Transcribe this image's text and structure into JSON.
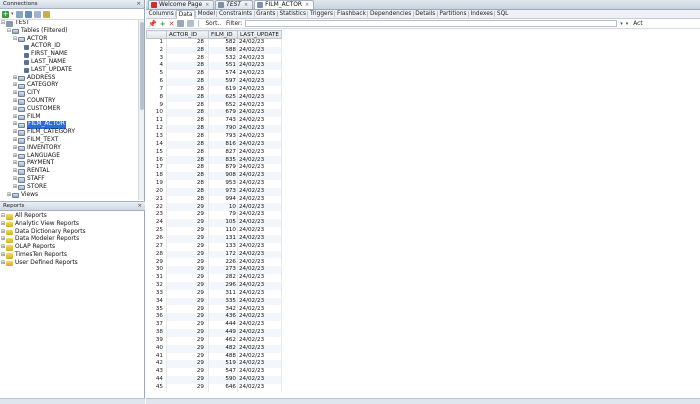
{
  "connections_panel": {
    "title": "Connections",
    "close": "×"
  },
  "tree": {
    "connection": "TEST",
    "tables_folder": "Tables (Filtered)",
    "actor_table": "ACTOR",
    "actor_columns": [
      "ACTOR_ID",
      "FIRST_NAME",
      "LAST_NAME",
      "LAST_UPDATE"
    ],
    "tables": [
      "ADDRESS",
      "CATEGORY",
      "CITY",
      "COUNTRY",
      "CUSTOMER",
      "FILM",
      "FILM_ACTOR",
      "FILM_CATEGORY",
      "FILM_TEXT",
      "INVENTORY",
      "LANGUAGE",
      "PAYMENT",
      "RENTAL",
      "STAFF",
      "STORE"
    ],
    "selected_table": "FILM_ACTOR",
    "views": "Views"
  },
  "reports_panel": {
    "title": "Reports",
    "close": "×",
    "root": "All Reports",
    "items": [
      "Analytic View Reports",
      "Data Dictionary Reports",
      "Data Modeler Reports",
      "OLAP Reports",
      "TimesTen Reports",
      "User Defined Reports"
    ]
  },
  "editor_tabs": [
    {
      "label": "Welcome Page",
      "icon": "oracle-icon",
      "active": false
    },
    {
      "label": "TEST",
      "icon": "connection-icon",
      "active": false
    },
    {
      "label": "FILM_ACTOR",
      "icon": "table-icon",
      "active": true
    }
  ],
  "editor_close": "×",
  "sub_tabs": [
    "Columns",
    "Data",
    "Model",
    "Constraints",
    "Grants",
    "Statistics",
    "Triggers",
    "Flashback",
    "Dependencies",
    "Details",
    "Partitions",
    "Indexes",
    "SQL"
  ],
  "active_sub_tab": "Data",
  "data_toolbar": {
    "sort_label": "Sort..",
    "filter_label": "Filter:",
    "filter_value": "",
    "actions_label": "Act"
  },
  "grid": {
    "columns": [
      "ACTOR_ID",
      "FILM_ID",
      "LAST_UPDATE"
    ],
    "rows": [
      [
        "1",
        "28",
        "582",
        "24/02/23"
      ],
      [
        "2",
        "28",
        "588",
        "24/02/23"
      ],
      [
        "3",
        "28",
        "532",
        "24/02/23"
      ],
      [
        "4",
        "28",
        "551",
        "24/02/23"
      ],
      [
        "5",
        "28",
        "574",
        "24/02/23"
      ],
      [
        "6",
        "28",
        "597",
        "24/02/23"
      ],
      [
        "7",
        "28",
        "619",
        "24/02/23"
      ],
      [
        "8",
        "28",
        "625",
        "24/02/23"
      ],
      [
        "9",
        "28",
        "652",
        "24/02/23"
      ],
      [
        "10",
        "28",
        "679",
        "24/02/23"
      ],
      [
        "11",
        "28",
        "743",
        "24/02/23"
      ],
      [
        "12",
        "28",
        "790",
        "24/02/23"
      ],
      [
        "13",
        "28",
        "793",
        "24/02/23"
      ],
      [
        "14",
        "28",
        "816",
        "24/02/23"
      ],
      [
        "15",
        "28",
        "827",
        "24/02/23"
      ],
      [
        "16",
        "28",
        "835",
        "24/02/23"
      ],
      [
        "17",
        "28",
        "879",
        "24/02/23"
      ],
      [
        "18",
        "28",
        "908",
        "24/02/23"
      ],
      [
        "19",
        "28",
        "953",
        "24/02/23"
      ],
      [
        "20",
        "28",
        "973",
        "24/02/23"
      ],
      [
        "21",
        "28",
        "994",
        "24/02/23"
      ],
      [
        "22",
        "29",
        "10",
        "24/02/23"
      ],
      [
        "23",
        "29",
        "79",
        "24/02/23"
      ],
      [
        "24",
        "29",
        "105",
        "24/02/23"
      ],
      [
        "25",
        "29",
        "110",
        "24/02/23"
      ],
      [
        "26",
        "29",
        "131",
        "24/02/23"
      ],
      [
        "27",
        "29",
        "133",
        "24/02/23"
      ],
      [
        "28",
        "29",
        "172",
        "24/02/23"
      ],
      [
        "29",
        "29",
        "226",
        "24/02/23"
      ],
      [
        "30",
        "29",
        "273",
        "24/02/23"
      ],
      [
        "31",
        "29",
        "282",
        "24/02/23"
      ],
      [
        "32",
        "29",
        "296",
        "24/02/23"
      ],
      [
        "33",
        "29",
        "311",
        "24/02/23"
      ],
      [
        "34",
        "29",
        "335",
        "24/02/23"
      ],
      [
        "35",
        "29",
        "342",
        "24/02/23"
      ],
      [
        "36",
        "29",
        "436",
        "24/02/23"
      ],
      [
        "37",
        "29",
        "444",
        "24/02/23"
      ],
      [
        "38",
        "29",
        "449",
        "24/02/23"
      ],
      [
        "39",
        "29",
        "462",
        "24/02/23"
      ],
      [
        "40",
        "29",
        "482",
        "24/02/23"
      ],
      [
        "41",
        "29",
        "488",
        "24/02/23"
      ],
      [
        "42",
        "29",
        "519",
        "24/02/23"
      ],
      [
        "43",
        "29",
        "547",
        "24/02/23"
      ],
      [
        "44",
        "29",
        "590",
        "24/02/23"
      ],
      [
        "45",
        "29",
        "646",
        "24/02/23"
      ]
    ]
  },
  "colors": {
    "selection": "#2e6bd8",
    "folder": "#e0b93a",
    "add_green": "#3c9a3c",
    "delete_red": "#c83a2f"
  }
}
